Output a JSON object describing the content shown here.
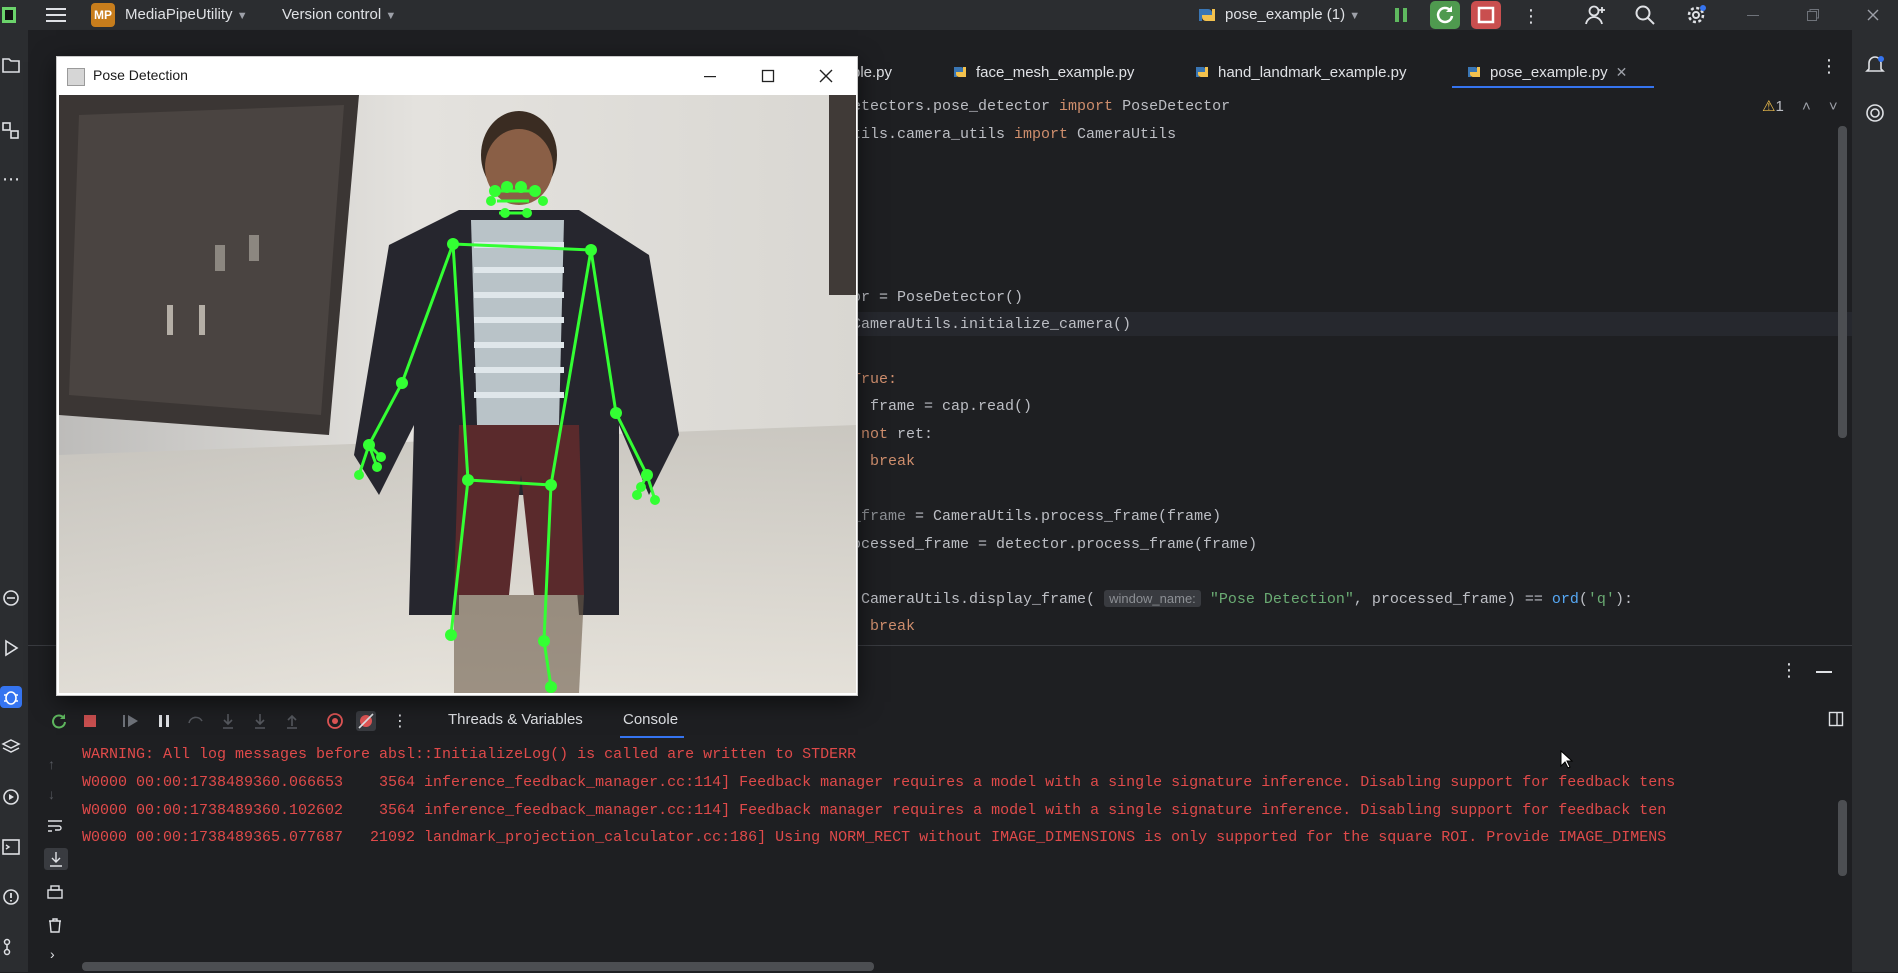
{
  "titlebar": {
    "app_badge": "MP",
    "project": "MediaPipeUtility",
    "vcs": "Version control",
    "run_config": "pose_example (1)"
  },
  "tabs": [
    {
      "label": "ple.py"
    },
    {
      "label": "face_mesh_example.py"
    },
    {
      "label": "hand_landmark_example.py"
    },
    {
      "label": "pose_example.py",
      "active": true
    }
  ],
  "editor": {
    "inspection_count": "1",
    "lines": [
      {
        "text_a": "etectors.pose_detector ",
        "kw1": "import",
        "text_b": " PoseDetector"
      },
      {
        "text_a": "tils.camera_utils ",
        "kw1": "import",
        "text_b": " CameraUtils"
      },
      {
        "l3_a": "or = PoseDetector()"
      },
      {
        "l4_a": "CameraUtils.initialize_camera()"
      },
      {
        "l5_kw": "True:"
      },
      {
        "l6_a": ", frame = cap.read()"
      },
      {
        "l7_kw": "not",
        "l7_b": " ret:"
      },
      {
        "l8_kw": "break"
      },
      {
        "l9_a": "_frame",
        "l9_b": " = CameraUtils.process_frame(frame)"
      },
      {
        "l10_a": "ocessed_frame = detector.process_frame(frame)"
      },
      {
        "l11_a": "CameraUtils.display_frame(",
        "hint": "window_name:",
        "str": "\"Pose Detection\"",
        "l11_b": ", processed_frame) == ",
        "fn": "ord",
        "l11_c": "(",
        "str2": "'q'",
        "l11_d": "):"
      },
      {
        "l12_kw": "break"
      }
    ]
  },
  "debug": {
    "tabs": [
      "Threads & Variables",
      "Console"
    ],
    "logs": [
      "WARNING: All log messages before absl::InitializeLog() is called are written to STDERR",
      "W0000 00:00:1738489360.066653    3564 inference_feedback_manager.cc:114] Feedback manager requires a model with a single signature inference. Disabling support for feedback tens",
      "W0000 00:00:1738489360.102602    3564 inference_feedback_manager.cc:114] Feedback manager requires a model with a single signature inference. Disabling support for feedback ten",
      "W0000 00:00:1738489365.077687   21092 landmark_projection_calculator.cc:186] Using NORM_RECT without IMAGE_DIMENSIONS is only supported for the square ROI. Provide IMAGE_DIMENS"
    ]
  },
  "pose_window": {
    "title": "Pose Detection"
  },
  "colors": {
    "accent": "#3574f0",
    "error_text": "#e04a4a",
    "skeleton": "#33ff33"
  }
}
